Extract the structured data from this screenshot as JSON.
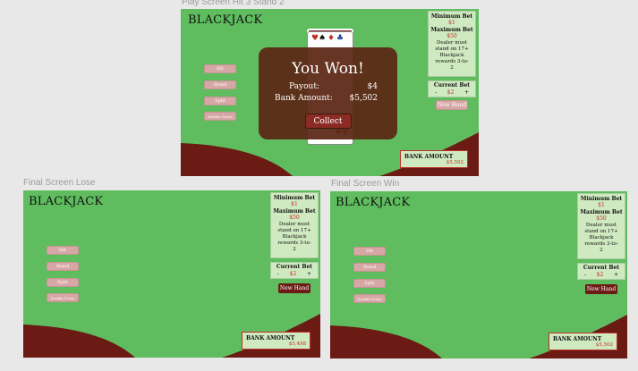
{
  "frames": {
    "hit3": {
      "label": "Play Screen Hit 3 Stand 2"
    },
    "lose": {
      "label": "Final Screen Lose"
    },
    "win": {
      "label": "Final Screen Win"
    }
  },
  "game": {
    "title": "BLACKJACK",
    "rules": {
      "min_label": "Minimum Bet",
      "min_value": "$1",
      "max_label": "Maximum Bet",
      "max_value": "$50",
      "dealer_text": "Dealer must stand on 17+",
      "payout_text": "Blackjack rewards 3-to-2"
    },
    "bet": {
      "label": "Current Bet",
      "minus": "-",
      "value": "$2",
      "plus": "+"
    },
    "buttons": {
      "hit": "Hit",
      "stand": "Stand",
      "split": "Split",
      "double": "Double Down",
      "new_hand": "New Hand"
    },
    "bank_label": "BANK AMOUNT",
    "colors": {
      "felt": "#5fbd5f",
      "wave": "#6b1a14",
      "accent_red": "#c0322a"
    }
  },
  "hit3": {
    "bank_value": "$5,502",
    "modal": {
      "title": "You Won!",
      "payout_label": "Payout:",
      "payout_value": "$4",
      "bank_label": "Bank Amount:",
      "bank_value": "$5,502",
      "collect": "Collect"
    }
  },
  "lose": {
    "bank_value": "$5,498"
  },
  "win": {
    "bank_value": "$5,502"
  }
}
